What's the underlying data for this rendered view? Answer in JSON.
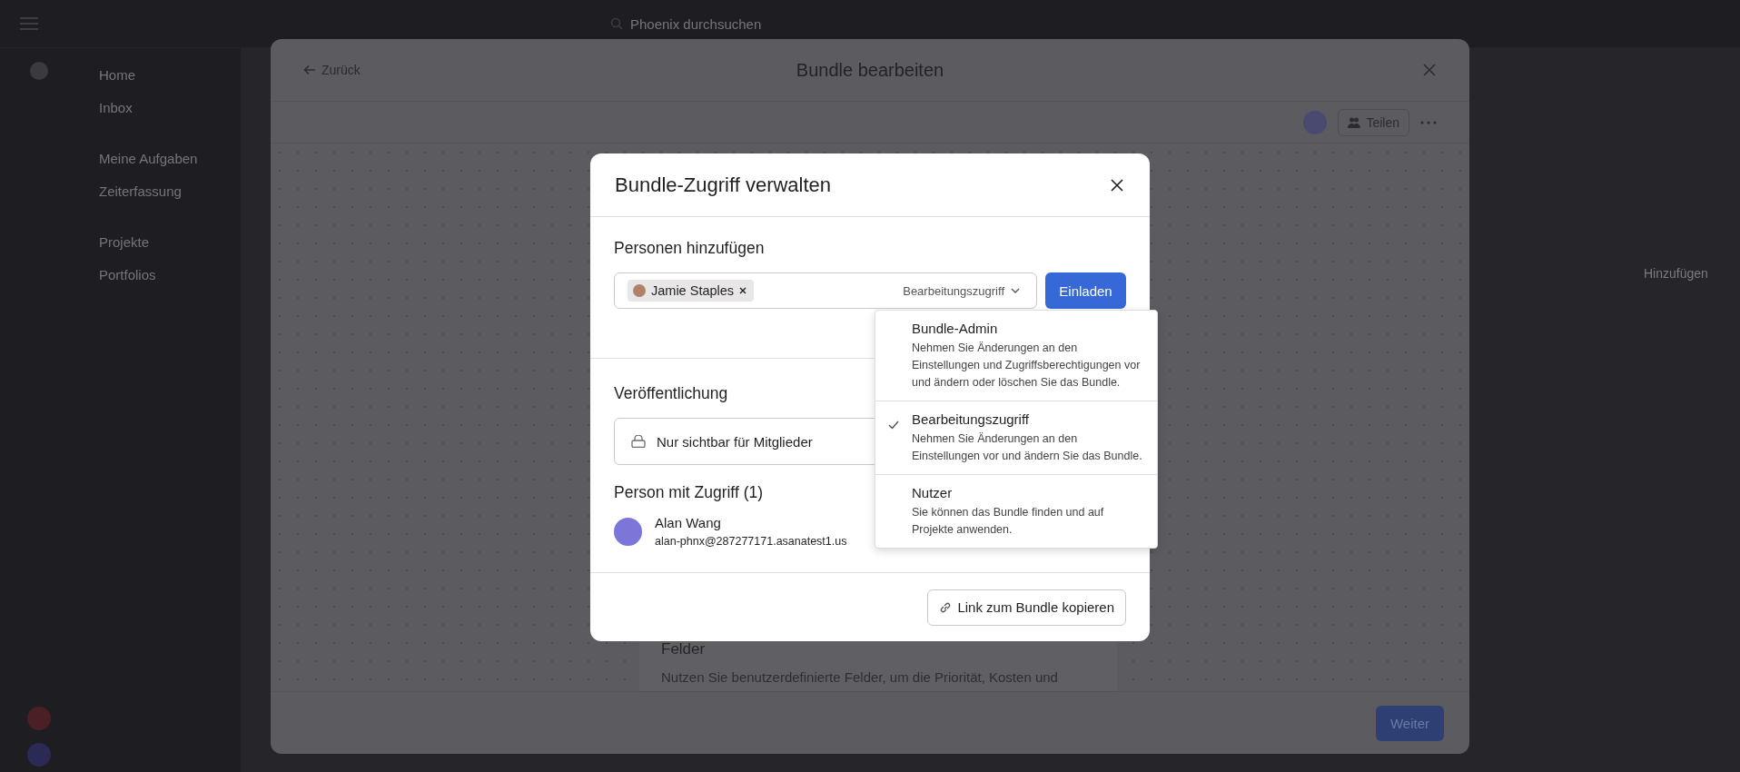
{
  "top_bar": {
    "search_placeholder": "Phoenix durchsuchen"
  },
  "sidebar": {
    "items": [
      {
        "label": "Home"
      },
      {
        "label": "Inbox"
      },
      {
        "label": "Meine Aufgaben"
      },
      {
        "label": "Zeiterfassung"
      },
      {
        "label": "Projekte"
      },
      {
        "label": "Portfolios"
      }
    ]
  },
  "background_panel": {
    "add_label": "Hinzufügen"
  },
  "editor": {
    "back": "Zurück",
    "title": "Bundle bearbeiten",
    "share": "Teilen",
    "card": {
      "title": "Felder",
      "text": "Nutzen Sie benutzerdefinierte Felder, um die Priorität, Kosten und"
    },
    "next": "Weiter"
  },
  "dialog": {
    "title": "Bundle-Zugriff verwalten",
    "add_heading": "Personen hinzufügen",
    "invitees": [
      {
        "name": "Jamie Staples"
      }
    ],
    "access_select": "Bearbeitungszugriff",
    "invite": "Einladen",
    "publish_heading": "Veröffentlichung",
    "visibility": "Nur sichtbar für Mitglieder",
    "members_heading": "Person mit Zugriff (1)",
    "members": [
      {
        "name": "Alan Wang",
        "email": "alan-phnx@287277171.asanatest1.us"
      }
    ],
    "copy_link": "Link zum Bundle kopieren"
  },
  "access_menu": {
    "options": [
      {
        "label": "Bundle-Admin",
        "description": "Nehmen Sie Änderungen an den Einstellungen und Zugriffsberechtigungen vor und ändern oder löschen Sie das Bundle.",
        "selected": false
      },
      {
        "label": "Bearbeitungszugriff",
        "description": "Nehmen Sie Änderungen an den Einstellungen vor und ändern Sie das Bundle.",
        "selected": true
      },
      {
        "label": "Nutzer",
        "description": "Sie können das Bundle finden und auf Projekte anwenden.",
        "selected": false
      }
    ]
  }
}
